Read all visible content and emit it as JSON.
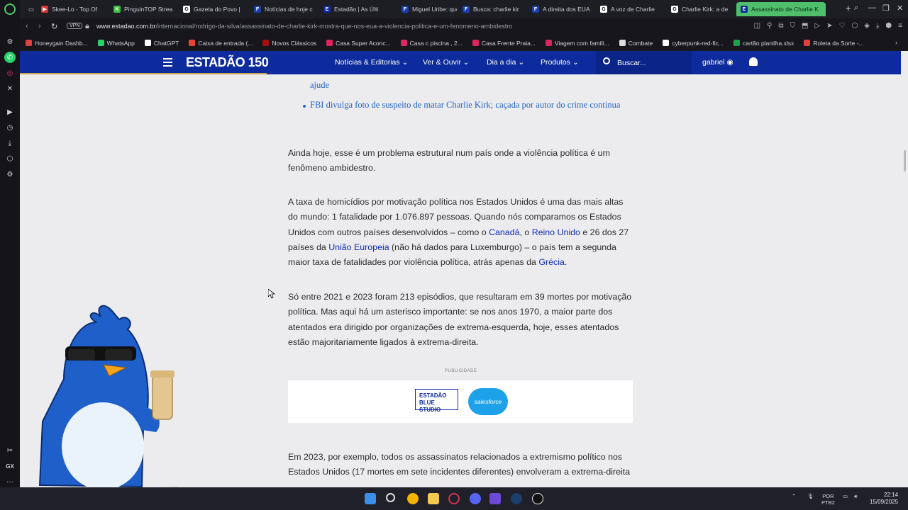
{
  "browser": {
    "tabs": [
      {
        "label": "Skee-Lo - Top Of",
        "color": "#e03030",
        "letter": "▶"
      },
      {
        "label": "PinguinTOP Strea",
        "color": "#3bbf3b",
        "letter": "K"
      },
      {
        "label": "Gazeta do Povo |",
        "color": "#ffffff",
        "letter": "G"
      },
      {
        "label": "Notícias de hoje c",
        "color": "#1a3fa8",
        "letter": "F"
      },
      {
        "label": "Estadão | As Últi",
        "color": "#0d2b9c",
        "letter": "E"
      },
      {
        "label": "Miguel Uribe: que",
        "color": "#1a3fa8",
        "letter": "F"
      },
      {
        "label": "Busca: charlie kir",
        "color": "#1a3fa8",
        "letter": "F"
      },
      {
        "label": "A direita dos EUA",
        "color": "#1a3fa8",
        "letter": "F"
      },
      {
        "label": "A voz de Charlie",
        "color": "#ffffff",
        "letter": "G"
      },
      {
        "label": "Charlie Kirk: a de",
        "color": "#ffffff",
        "letter": "G"
      },
      {
        "label": "Assassinato de Charlie K",
        "color": "#0d2b9c",
        "letter": "E",
        "active": true
      }
    ],
    "new_tab": "+",
    "vpn_label": "VPN",
    "url_host": "www.estadao.com.br",
    "url_path": "/internacional/rodrigo-da-silva/assassinato-de-charlie-kirk-mostra-que-nos-eua-a-violencia-politica-e-um-fenomeno-ambidestro",
    "bookmarks": [
      {
        "label": "Honeygain Dashb...",
        "color": "#e04040"
      },
      {
        "label": "WhatsApp",
        "color": "#25d366"
      },
      {
        "label": "ChatGPT",
        "color": "#ffffff"
      },
      {
        "label": "Caixa de entrada (...",
        "color": "#ea4335"
      },
      {
        "label": "Novos Clássicos",
        "color": "#a01010"
      },
      {
        "label": "Casa Super Aconc...",
        "color": "#e0245e"
      },
      {
        "label": "Casa c piscina , 2...",
        "color": "#e0245e"
      },
      {
        "label": "Casa Frente Praia...",
        "color": "#e0245e"
      },
      {
        "label": "Viagem com famíli...",
        "color": "#e0245e"
      },
      {
        "label": "Combate",
        "color": "#dddddd"
      },
      {
        "label": "cyberpunk-red-fic...",
        "color": "#ffffff"
      },
      {
        "label": "cartão planilha.xlsx",
        "color": "#1e9e50"
      },
      {
        "label": "Roleta da Sorte -...",
        "color": "#e04040"
      }
    ]
  },
  "site": {
    "logo": "ESTADÃO 150",
    "menu": [
      "Notícias & Editorias",
      "Ver & Ouvir",
      "Dia a dia",
      "Produtos"
    ],
    "search_label": "Buscar...",
    "user": "gabriel"
  },
  "article": {
    "related_partial": "ajude",
    "related_link": "FBI divulga foto de suspeito de matar Charlie Kirk; caçada por autor do crime continua",
    "p1": "Ainda hoje, esse é um problema estrutural num país onde a violência política é um fenômeno ambidestro.",
    "p2_a": "A taxa de homicídios por motivação política nos Estados Unidos é uma das mais altas do mundo: 1 fatalidade por 1.076.897 pessoas. Quando nós comparamos os Estados Unidos com outros países desenvolvidos – como o ",
    "p2_link1": "Canadá",
    "p2_b": ", o ",
    "p2_link2": "Reino Unido",
    "p2_c": " e 26 dos 27 países da ",
    "p2_link3": "União Europeia",
    "p2_d": " (não há dados para Luxemburgo) – o país tem a segunda maior taxa de fatalidades por violência política, atrás apenas da ",
    "p2_link4": "Grécia",
    "p2_e": ".",
    "p3": "Só entre 2021 e 2023 foram 213 episódios, que resultaram em 39 mortes por motivação política. Mas aqui há um asterisco importante: se nos anos 1970, a maior parte dos atentados era dirigido por organizações de extrema-esquerda, hoje, esses atentados estão majoritariamente ligados à extrema-direita.",
    "ad_label": "PUBLICIDADE",
    "ad_brand1": "ESTADÃO BLUE STUDIO",
    "ad_brand2": "salesforce",
    "p4": "Em 2023, por exemplo, todos os assassinatos relacionados a extremismo político nos Estados Unidos (17 mortes em sete incidentes diferentes) envolveram a extrema-direita"
  },
  "taskbar": {
    "lang": "POR",
    "layout": "PTB2",
    "time": "22:14",
    "date": "15/09/2025"
  }
}
